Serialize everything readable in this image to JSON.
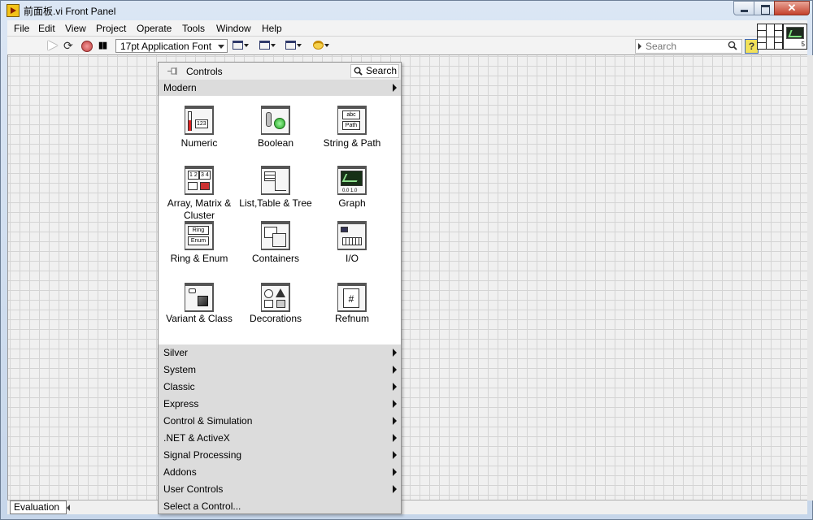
{
  "window": {
    "title": "前面板.vi Front Panel",
    "close_glyph": "✕"
  },
  "menubar": [
    "File",
    "Edit",
    "View",
    "Project",
    "Operate",
    "Tools",
    "Window",
    "Help"
  ],
  "toolbar": {
    "font_select": "17pt Application Font",
    "search_placeholder": "Search",
    "help_glyph": "?"
  },
  "palette": {
    "title": "Controls",
    "search_label": "Search",
    "top_category": "Modern",
    "items": [
      {
        "label": "Numeric",
        "icon": "numeric-icon"
      },
      {
        "label": "Boolean",
        "icon": "boolean-icon"
      },
      {
        "label": "String & Path",
        "icon": "string-path-icon"
      },
      {
        "label": "Array, Matrix & Cluster",
        "icon": "array-matrix-cluster-icon"
      },
      {
        "label": "List,Table & Tree",
        "icon": "list-table-tree-icon"
      },
      {
        "label": "Graph",
        "icon": "graph-icon"
      },
      {
        "label": "Ring & Enum",
        "icon": "ring-enum-icon"
      },
      {
        "label": "Containers",
        "icon": "containers-icon"
      },
      {
        "label": "I/O",
        "icon": "io-icon"
      },
      {
        "label": "Variant & Class",
        "icon": "variant-class-icon"
      },
      {
        "label": "Decorations",
        "icon": "decorations-icon"
      },
      {
        "label": "Refnum",
        "icon": "refnum-icon"
      }
    ],
    "categories": [
      "Silver",
      "System",
      "Classic",
      "Express",
      "Control & Simulation",
      ".NET & ActiveX",
      "Signal Processing",
      "Addons",
      "User Controls",
      "Select a Control..."
    ],
    "icon_text": {
      "numeric": "123",
      "string_abc": "abc",
      "string_path": "Path",
      "array_a": "1 2",
      "array_b": "3 4",
      "ring": "Ring",
      "enum": "Enum",
      "refnum": "#",
      "io_value": "0.0 1.0"
    }
  },
  "status": {
    "label": "Evaluation"
  },
  "connector_pane": {
    "number": "5"
  }
}
